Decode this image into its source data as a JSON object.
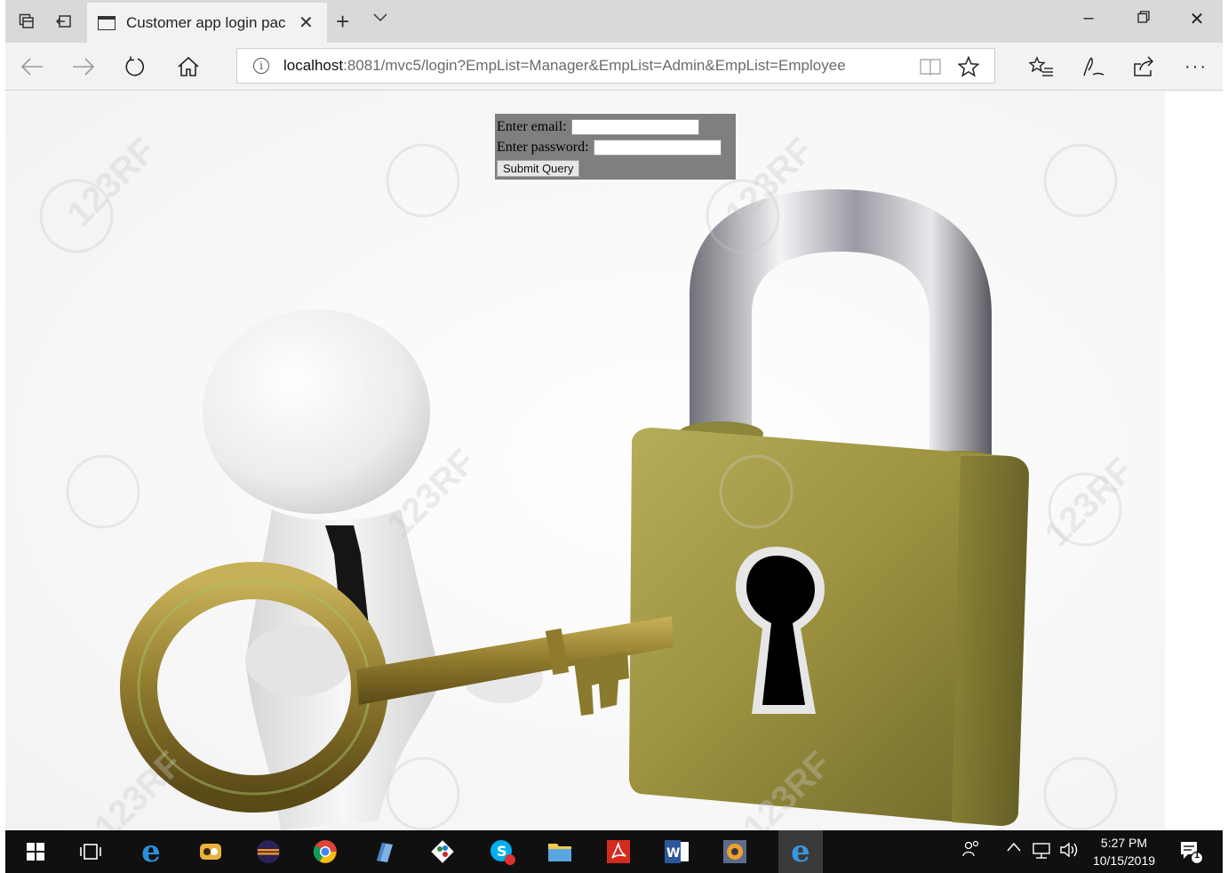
{
  "browser": {
    "tab_title": "Customer app login page",
    "tab_title_visible": "Customer app login pac",
    "url_host": "localhost",
    "url_rest": ":8081/mvc5/login?EmpList=Manager&EmpList=Admin&EmpList=Employee",
    "icons": [
      "tab-actions-icon",
      "tab-back-icon",
      "page-icon",
      "close-icon",
      "new-tab-icon",
      "chevron-down-icon",
      "minimize-icon",
      "restore-icon",
      "window-close-icon",
      "back-arrow-icon",
      "forward-arrow-icon",
      "refresh-icon",
      "home-icon",
      "info-icon",
      "reading-view-icon",
      "favorite-star-icon",
      "favorites-list-icon",
      "pen-icon",
      "share-icon",
      "more-icon"
    ]
  },
  "login": {
    "email_label": "Enter email:",
    "email_value": "",
    "password_label": "Enter password:",
    "password_value": "",
    "submit_label": "Submit Query"
  },
  "watermark": {
    "text": "123RF"
  },
  "taskbar": {
    "time": "5:27 PM",
    "date": "10/15/2019",
    "notification_count": "1",
    "apps": [
      "windows-start-icon",
      "task-view-icon",
      "internet-explorer-icon",
      "app-icon",
      "eclipse-icon",
      "chrome-icon",
      "app-icon",
      "git-icon",
      "skype-icon",
      "file-explorer-icon",
      "acrobat-icon",
      "word-icon",
      "app-icon",
      "edge-icon"
    ]
  },
  "colors": {
    "form_bg": "#7f7f7f",
    "lock_body": "#9c9240",
    "key_gold": "#8f7a2e",
    "taskbar_bg": "#101010"
  }
}
